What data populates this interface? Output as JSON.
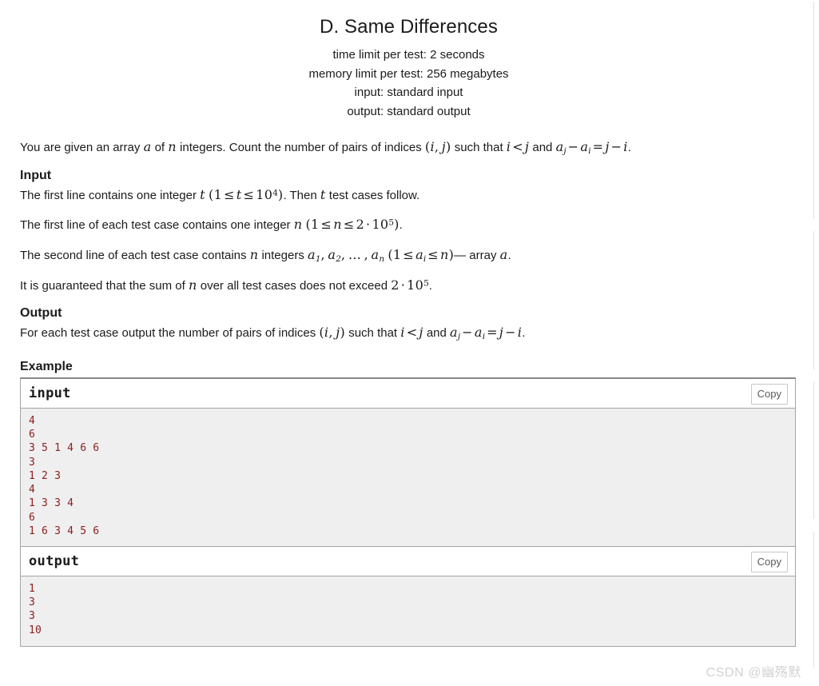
{
  "header": {
    "title": "D. Same Differences",
    "limits": [
      "time limit per test: 2 seconds",
      "memory limit per test: 256 megabytes",
      "input: standard input",
      "output: standard output"
    ]
  },
  "legend": {
    "statement_p1": "You are given an array",
    "statement_a": "a",
    "statement_p2": "of",
    "statement_n": "n",
    "statement_p3": "integers. Count the number of pairs of indices",
    "statement_pair": "(i, j)",
    "statement_p4": "such that",
    "statement_ilj": "i < j",
    "statement_p5": "and",
    "statement_eq": "aⱼ − aᵢ = j − i",
    "statement_end": "."
  },
  "input_section": {
    "title": "Input",
    "line1_a": "The first line contains one integer",
    "line1_t": "t",
    "line1_constraint": "(1 ≤ t ≤ 10⁴)",
    "line1_b": ". Then",
    "line1_t2": "t",
    "line1_c": "test cases follow.",
    "line2_a": "The first line of each test case contains one integer",
    "line2_n": "n",
    "line2_constraint": "(1 ≤ n ≤ 2 · 10⁵)",
    "line2_end": ".",
    "line3_a": "The second line of each test case contains",
    "line3_n": "n",
    "line3_b": "integers",
    "line3_list": "a₁, a₂, …, aₙ",
    "line3_constraint": "(1 ≤ aᵢ ≤ n)",
    "line3_dash": "— array",
    "line3_a_var": "a",
    "line3_end": ".",
    "line4_a": "It is guaranteed that the sum of",
    "line4_n": "n",
    "line4_b": "over all test cases does not exceed",
    "line4_val": "2 · 10⁵",
    "line4_end": "."
  },
  "output_section": {
    "title": "Output",
    "line1_a": "For each test case output the number of pairs of indices",
    "line1_pair": "(i, j)",
    "line1_b": "such that",
    "line1_ilj": "i < j",
    "line1_c": "and",
    "line1_eq": "aⱼ − aᵢ = j − i",
    "line1_end": "."
  },
  "example": {
    "title": "Example",
    "copy_label": "Copy",
    "blocks": [
      {
        "label": "input",
        "text": "4\n6\n3 5 1 4 6 6\n3\n1 2 3\n4\n1 3 3 4\n6\n1 6 3 4 5 6"
      },
      {
        "label": "output",
        "text": "1\n3\n3\n10"
      }
    ]
  },
  "watermark": {
    "text": "CSDN @幽殇默"
  }
}
